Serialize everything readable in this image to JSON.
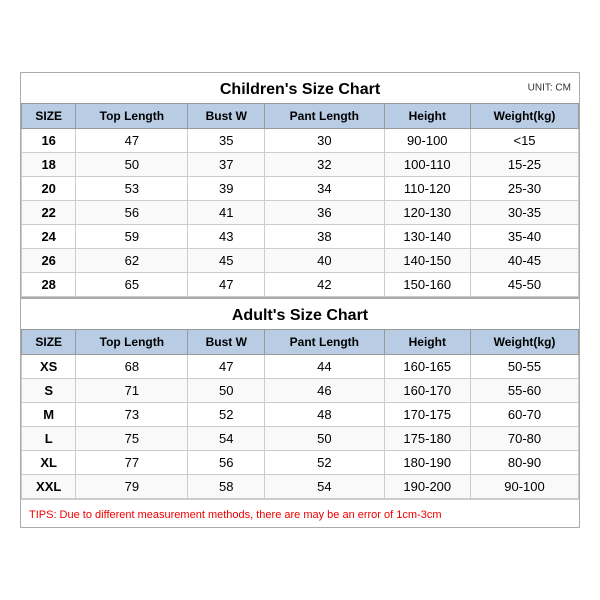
{
  "children": {
    "title": "Children's Size Chart",
    "unit": "UNIT: CM",
    "headers": [
      "SIZE",
      "Top Length",
      "Bust W",
      "Pant Length",
      "Height",
      "Weight(kg)"
    ],
    "rows": [
      [
        "16",
        "47",
        "35",
        "30",
        "90-100",
        "<15"
      ],
      [
        "18",
        "50",
        "37",
        "32",
        "100-110",
        "15-25"
      ],
      [
        "20",
        "53",
        "39",
        "34",
        "110-120",
        "25-30"
      ],
      [
        "22",
        "56",
        "41",
        "36",
        "120-130",
        "30-35"
      ],
      [
        "24",
        "59",
        "43",
        "38",
        "130-140",
        "35-40"
      ],
      [
        "26",
        "62",
        "45",
        "40",
        "140-150",
        "40-45"
      ],
      [
        "28",
        "65",
        "47",
        "42",
        "150-160",
        "45-50"
      ]
    ]
  },
  "adults": {
    "title": "Adult's Size Chart",
    "headers": [
      "SIZE",
      "Top Length",
      "Bust W",
      "Pant Length",
      "Height",
      "Weight(kg)"
    ],
    "rows": [
      [
        "XS",
        "68",
        "47",
        "44",
        "160-165",
        "50-55"
      ],
      [
        "S",
        "71",
        "50",
        "46",
        "160-170",
        "55-60"
      ],
      [
        "M",
        "73",
        "52",
        "48",
        "170-175",
        "60-70"
      ],
      [
        "L",
        "75",
        "54",
        "50",
        "175-180",
        "70-80"
      ],
      [
        "XL",
        "77",
        "56",
        "52",
        "180-190",
        "80-90"
      ],
      [
        "XXL",
        "79",
        "58",
        "54",
        "190-200",
        "90-100"
      ]
    ]
  },
  "tips": "TIPS: Due to different measurement methods, there are may be an error of 1cm-3cm"
}
